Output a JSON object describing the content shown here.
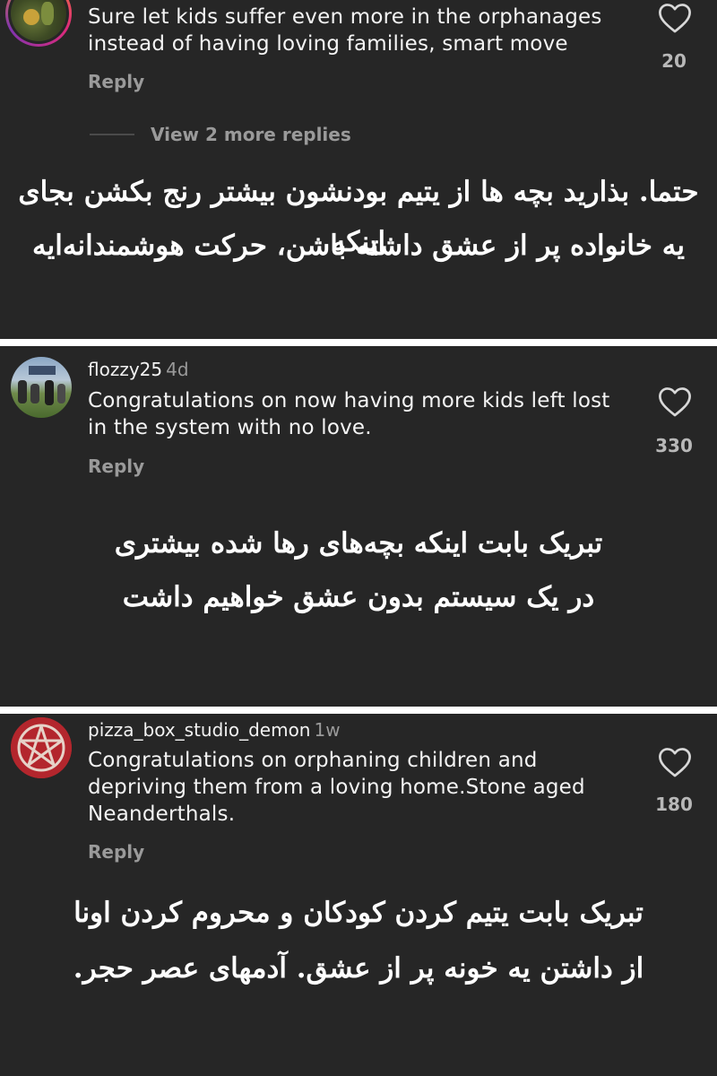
{
  "comments": [
    {
      "username": "",
      "time": "",
      "text": "Sure let kids suffer even more in the orphanages instead of having loving families, smart move",
      "likes": "20",
      "reply_label": "Reply",
      "view_more_label": "View 2 more replies",
      "translation_line1": "حتما. بذارید بچه ها از یتیم بودنشون بیشتر رنج بکشن بجای اینکه",
      "translation_line2": "یه خانواده پر از عشق داشته باشن، حرکت هوشمندانه‌ایه"
    },
    {
      "username": "flozzy25",
      "time": "4d",
      "text": "Congratulations on now having more kids left lost in the system with no love.",
      "likes": "330",
      "reply_label": "Reply",
      "translation_line1": "تبریک بابت اینکه بچه‌های رها شده بیشتری",
      "translation_line2": "در یک سیستم بدون عشق خواهیم داشت"
    },
    {
      "username": "pizza_box_studio_demon",
      "time": "1w",
      "text": "Congratulations on orphaning children and depriving them from a loving home.Stone aged Neanderthals.",
      "likes": "180",
      "reply_label": "Reply",
      "translation_line1": "تبریک بابت یتیم کردن کودکان و محروم کردن اونا",
      "translation_line2": "از داشتن یه خونه پر از عشق. آدمهای عصر حجر."
    }
  ],
  "icons": {
    "like": "heart-outline-icon",
    "avatar_pentagram": "pentagram-icon"
  },
  "colors": {
    "background": "#262626",
    "divider": "#ffffff",
    "muted_text": "#9a9a9a",
    "pentagram_red": "#b3262d"
  }
}
